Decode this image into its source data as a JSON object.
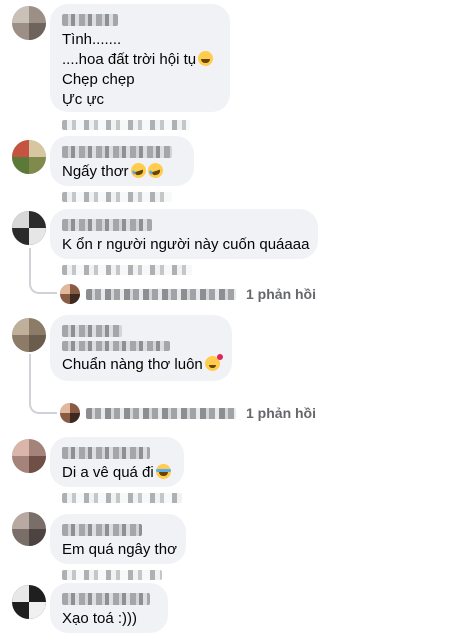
{
  "comments": [
    {
      "lines": [
        "Tình.......",
        "....hoa đất trời hội tụ",
        "Chẹp chẹp",
        "Ực ực"
      ],
      "emoji": "grinning-sweat-emoji"
    },
    {
      "lines": [
        "Ngấy thơr"
      ],
      "emoji": "rolling-laughing-emoji"
    },
    {
      "lines": [
        "K ổn r người người này cuốn quáaaa"
      ],
      "reply_count": "1 phản hồi"
    },
    {
      "lines": [
        "Chuẩn nàng thơ luôn"
      ],
      "emoji": "smiling-hearts-emoji",
      "reply_count": "1 phản hồi"
    },
    {
      "lines": [
        "Di a vê quá đi"
      ],
      "emoji": "tears-of-joy-emoji"
    },
    {
      "lines": [
        "Em quá ngây thơ"
      ]
    },
    {
      "lines": [
        "Xạo toá :)))"
      ]
    }
  ],
  "colors": {
    "bubble": "#f0f2f5",
    "text": "#050505",
    "secondary": "#65676b",
    "connector": "#cfd2d6"
  }
}
